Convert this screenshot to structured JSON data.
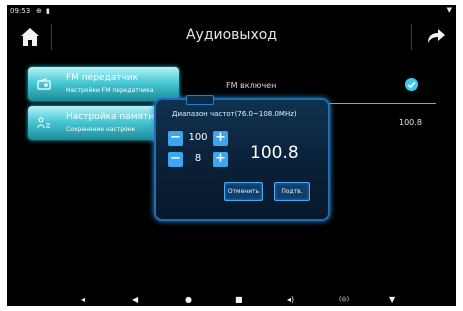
{
  "status_bar": {
    "time": "09:53"
  },
  "header": {
    "title": "Аудиовыход"
  },
  "side_buttons": [
    {
      "title": "FM передатчик",
      "subtitle": "Настройки FM передатчика"
    },
    {
      "title": "Настройка памяти",
      "subtitle": "Сохранение настроек"
    }
  ],
  "settings": {
    "fm_enabled_label": "FM включен",
    "fm_enabled": true,
    "frequency_value": "100.8"
  },
  "dialog": {
    "title": "Диапазон частот(76.0~108.0MHz)",
    "integer_value": "100",
    "decimal_value": "8",
    "frequency_display": "100.8",
    "cancel_label": "Отменить",
    "confirm_label": "Подтв."
  },
  "colors": {
    "accent": "#3aa8ee",
    "button_cyan": "#49c9d5",
    "dialog_border": "#1d6fb2"
  }
}
